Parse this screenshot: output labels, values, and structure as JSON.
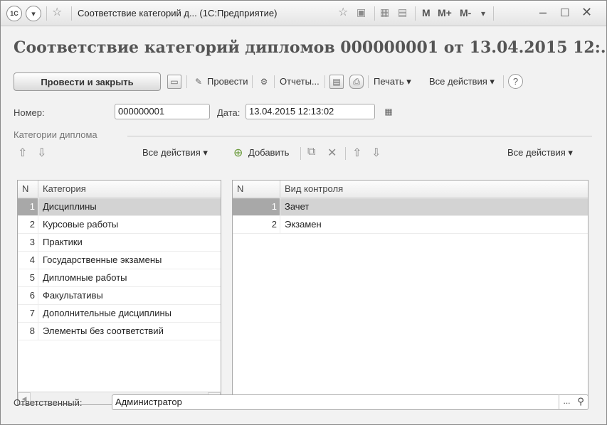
{
  "window": {
    "title": "Соответствие категорий д... (1С:Предприятие)",
    "logo_text": "1С",
    "controls": {
      "m": "M",
      "m_plus": "M+",
      "m_minus": "M-"
    }
  },
  "form": {
    "title": "Соответствие категорий дипломов 000000001 от 13.04.2015 12:..."
  },
  "toolbar": {
    "post_and_close": "Провести и закрыть",
    "post": "Провести",
    "reports": "Отчеты...",
    "print": "Печать ▾",
    "all_actions": "Все действия ▾",
    "help": "?"
  },
  "fields": {
    "number_label": "Номер:",
    "number_value": "000000001",
    "date_label": "Дата:",
    "date_value": "13.04.2015 12:13:02",
    "group_label": "Категории диплома",
    "responsible_label": "Ответственный:",
    "responsible_value": "Администратор",
    "dots": "..."
  },
  "left_panel": {
    "all_actions": "Все действия ▾",
    "columns": {
      "n": "N",
      "category": "Категория"
    },
    "rows": [
      {
        "n": "1",
        "category": "Дисциплины",
        "selected": true
      },
      {
        "n": "2",
        "category": "Курсовые работы"
      },
      {
        "n": "3",
        "category": "Практики"
      },
      {
        "n": "4",
        "category": "Государственные экзамены"
      },
      {
        "n": "5",
        "category": "Дипломные работы"
      },
      {
        "n": "6",
        "category": "Факультативы"
      },
      {
        "n": "7",
        "category": "Дополнительные дисциплины"
      },
      {
        "n": "8",
        "category": "Элементы без соответствий"
      }
    ]
  },
  "right_panel": {
    "add": "Добавить",
    "all_actions": "Все действия ▾",
    "columns": {
      "n": "N",
      "control_type": "Вид контроля"
    },
    "rows": [
      {
        "n": "1",
        "control_type": "Зачет",
        "selected": true
      },
      {
        "n": "2",
        "control_type": "Экзамен"
      }
    ]
  },
  "icons": [
    "logo-icon",
    "dropdown-circle-icon",
    "star-icon",
    "save-icon",
    "post-icon",
    "reports-icon",
    "print-preview-icon",
    "printer-icon",
    "help-icon",
    "calendar-icon",
    "arrow-up-icon",
    "arrow-down-icon",
    "add-icon",
    "copy-icon",
    "delete-icon",
    "search-icon"
  ],
  "colors": {
    "selected_row": "#d3d3d3",
    "selected_cell": "#a8a8a8",
    "background": "#f2f2f2"
  }
}
